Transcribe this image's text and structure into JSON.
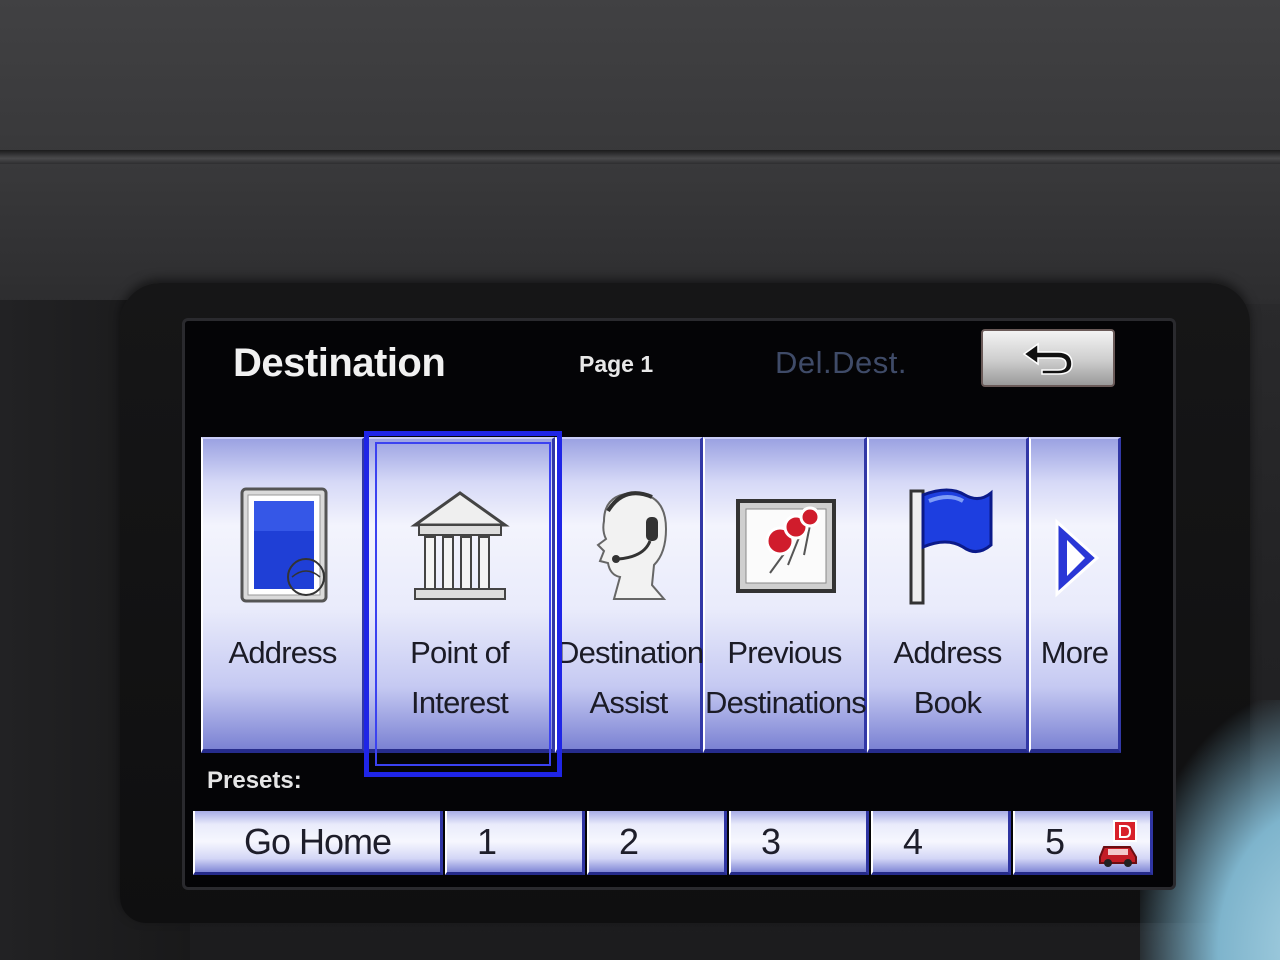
{
  "header": {
    "title": "Destination",
    "page": "Page 1",
    "delete_destination": "Del.Dest.",
    "back_icon": "back-arrow-icon"
  },
  "menu": {
    "items": [
      {
        "line1": "Address",
        "line2": "",
        "icon": "address-card-icon"
      },
      {
        "line1": "Point of",
        "line2": "Interest",
        "icon": "building-columns-icon",
        "selected": true
      },
      {
        "line1": "Destination",
        "line2": "Assist",
        "icon": "headset-operator-icon"
      },
      {
        "line1": "Previous",
        "line2": "Destinations",
        "icon": "map-pins-icon"
      },
      {
        "line1": "Address",
        "line2": "Book",
        "icon": "blue-flag-icon"
      },
      {
        "line1": "More",
        "line2": "",
        "icon": "play-triangle-icon"
      }
    ]
  },
  "presets": {
    "label": "Presets:",
    "items": [
      "Go Home",
      "1",
      "2",
      "3",
      "4",
      "5"
    ],
    "last_icon": "car-destination-icon"
  },
  "colors": {
    "tile_accent": "#2a30b0",
    "selection": "#1f25e6",
    "disabled_text": "#3f4b68"
  }
}
